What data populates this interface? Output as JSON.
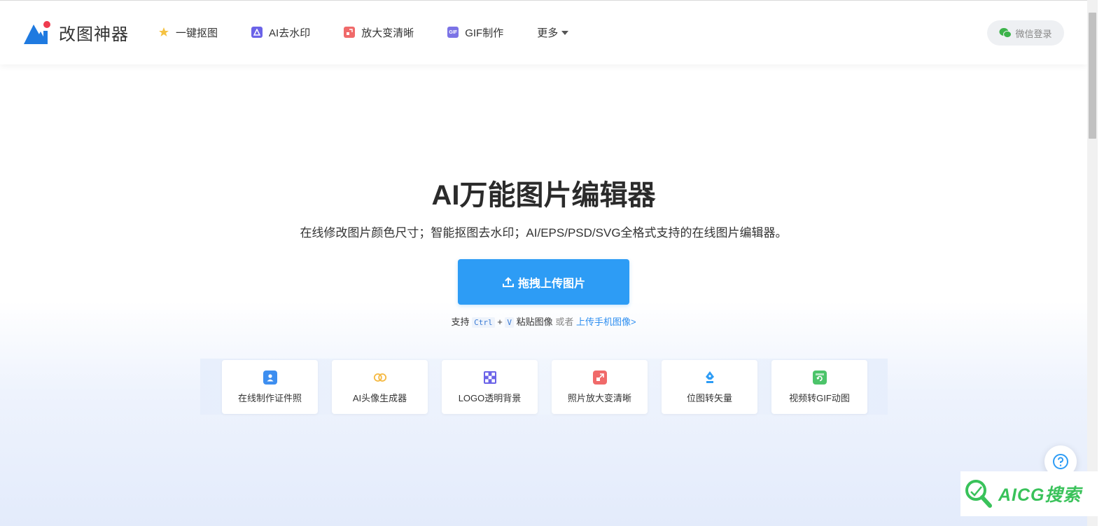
{
  "header": {
    "logo_text": "改图神器",
    "nav": [
      {
        "label": "一键抠图",
        "icon": "magic-wand-icon",
        "color": "#f5b942"
      },
      {
        "label": "AI去水印",
        "icon": "watermark-icon",
        "color": "#6b63e8"
      },
      {
        "label": "放大变清晰",
        "icon": "enlarge-icon",
        "color": "#f06a6a"
      },
      {
        "label": "GIF制作",
        "icon": "gif-icon",
        "color": "#7b73e6"
      },
      {
        "label": "更多",
        "icon": "chevron-down-icon"
      }
    ],
    "login_label": "微信登录"
  },
  "hero": {
    "title": "AI万能图片编辑器",
    "subtitle": "在线修改图片颜色尺寸；智能抠图去水印；AI/EPS/PSD/SVG全格式支持的在线图片编辑器。",
    "upload_label": "拖拽上传图片",
    "hint": {
      "prefix": "支持",
      "key1": "Ctrl",
      "plus": "+",
      "key2": "V",
      "suffix": "粘贴图像",
      "or": "或者",
      "link": "上传手机图像>"
    }
  },
  "tools": [
    {
      "label": "在线制作证件照",
      "icon": "id-photo-icon",
      "color": "#3d8ef0"
    },
    {
      "label": "AI头像生成器",
      "icon": "avatar-generator-icon",
      "color": "#f5b942"
    },
    {
      "label": "LOGO透明背景",
      "icon": "transparent-grid-icon",
      "color": "#6b63e8"
    },
    {
      "label": "照片放大变清晰",
      "icon": "enlarge-icon",
      "color": "#f06a6a"
    },
    {
      "label": "位图转矢量",
      "icon": "pen-tool-icon",
      "color": "#2d9cf5"
    },
    {
      "label": "视频转GIF动图",
      "icon": "video-gif-icon",
      "color": "#4cc46a"
    }
  ],
  "watermark": {
    "text": "AICG搜索",
    "color": "#39c25a"
  },
  "colors": {
    "primary": "#2d9cf5",
    "link": "#2d8ef0"
  }
}
